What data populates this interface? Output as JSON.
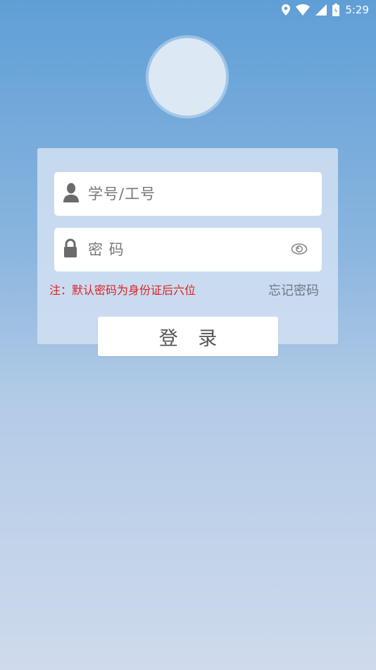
{
  "status_bar": {
    "time": "5:29",
    "icons": [
      "location-icon",
      "wifi-icon",
      "signal-icon",
      "battery-icon"
    ]
  },
  "login": {
    "username_placeholder": "学号/工号",
    "password_placeholder": "密 码",
    "hint": "注：默认密码为身份证后六位",
    "forgot_password": "忘记密码",
    "login_button": "登 录"
  },
  "colors": {
    "hint": "#e02020",
    "background_top": "#5f9fd6",
    "background_bottom": "#cfdaec"
  }
}
